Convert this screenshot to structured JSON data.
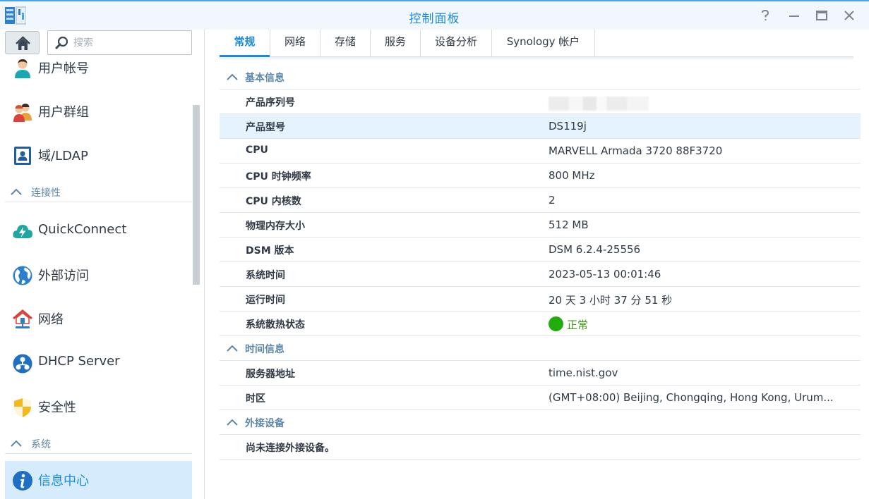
{
  "window": {
    "title": "控制面板",
    "controls": [
      "help-icon",
      "minimize-icon",
      "maximize-icon",
      "close-icon"
    ]
  },
  "sidebar": {
    "search_placeholder": "搜索",
    "items": [
      {
        "label": "用户帐号",
        "icon": "user-icon"
      },
      {
        "label": "用户群组",
        "icon": "user-group-icon"
      },
      {
        "label": "域/LDAP",
        "icon": "domain-ldap-icon"
      },
      {
        "label": "QuickConnect",
        "icon": "quickconnect-icon"
      },
      {
        "label": "外部访问",
        "icon": "globe-icon"
      },
      {
        "label": "网络",
        "icon": "network-house-icon"
      },
      {
        "label": "DHCP Server",
        "icon": "dhcp-icon"
      },
      {
        "label": "安全性",
        "icon": "shield-icon"
      },
      {
        "label": "信息中心",
        "icon": "info-icon",
        "active": true
      }
    ],
    "sections": {
      "connectivity": "连接性",
      "system": "系统"
    }
  },
  "tabs": [
    {
      "label": "常规",
      "active": true
    },
    {
      "label": "网络"
    },
    {
      "label": "存储"
    },
    {
      "label": "服务"
    },
    {
      "label": "设备分析"
    },
    {
      "label": "Synology 帐户"
    }
  ],
  "info": {
    "basic": {
      "title": "基本信息",
      "rows": [
        {
          "key": "产品序列号",
          "value": ""
        },
        {
          "key": "产品型号",
          "value": "DS119j"
        },
        {
          "key": "CPU",
          "value": "MARVELL Armada 3720 88F3720"
        },
        {
          "key": "CPU 时钟频率",
          "value": "800 MHz"
        },
        {
          "key": "CPU 内核数",
          "value": "2"
        },
        {
          "key": "物理内存大小",
          "value": "512 MB"
        },
        {
          "key": "DSM 版本",
          "value": "DSM 6.2.4-25556"
        },
        {
          "key": "系统时间",
          "value": "2023-05-13 00:01:46"
        },
        {
          "key": "运行时间",
          "value": "20 天 3 小时 37 分 51 秒"
        },
        {
          "key": "系统散热状态",
          "value": "正常"
        }
      ]
    },
    "time": {
      "title": "时间信息",
      "rows": [
        {
          "key": "服务器地址",
          "value": "time.nist.gov"
        },
        {
          "key": "时区",
          "value": "(GMT+08:00) Beijing, Chongqing, Hong Kong, Urum..."
        }
      ]
    },
    "external": {
      "title": "外接设备",
      "rows": [
        {
          "key": "尚未连接外接设备。"
        }
      ]
    }
  },
  "colors": {
    "accent": "#1a8bd9",
    "status_ok": "#21ad0d",
    "section_text": "#5d87a8",
    "highlight_row": "#e4f3fd"
  }
}
